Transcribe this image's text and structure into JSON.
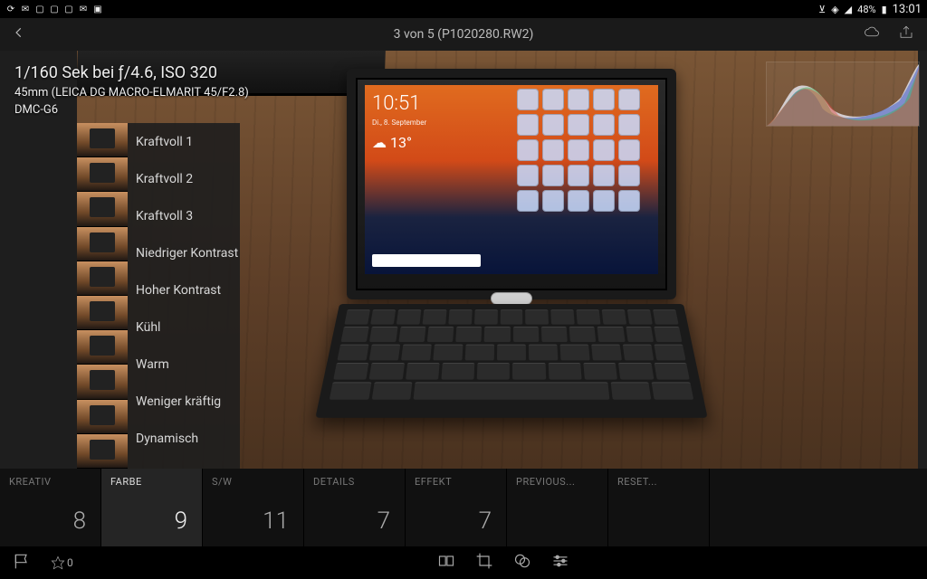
{
  "status_bar": {
    "left_icons": [
      "sync",
      "mail",
      "cal1",
      "cal2",
      "cal3",
      "msg",
      "image"
    ],
    "bluetooth": true,
    "wifi": true,
    "signal": true,
    "battery_pct": "48%",
    "time": "13:01"
  },
  "top": {
    "counter": "3 von 5 (P1020280.RW2)",
    "cloud": "cloud",
    "share": "share"
  },
  "metadata": {
    "exposure": "1/160 Sek bei ƒ/4.6, ISO 320",
    "lens": "45mm (LEICA DG MACRO-ELMARIT 45/F2.8)",
    "camera": "DMC-G6"
  },
  "presets": {
    "items": [
      {
        "label": "Kraftvoll 1"
      },
      {
        "label": "Kraftvoll 2"
      },
      {
        "label": "Kraftvoll 3"
      },
      {
        "label": "Niedriger Kontrast"
      },
      {
        "label": "Hoher Kontrast"
      },
      {
        "label": "Kühl"
      },
      {
        "label": "Warm"
      },
      {
        "label": "Weniger kräftig"
      },
      {
        "label": "Dynamisch"
      }
    ]
  },
  "tabs": {
    "items": [
      {
        "label": "KREATIV",
        "value": "8"
      },
      {
        "label": "FARBE",
        "value": "9",
        "active": true
      },
      {
        "label": "S/W",
        "value": "11"
      },
      {
        "label": "DETAILS",
        "value": "7"
      },
      {
        "label": "EFFEKT",
        "value": "7"
      },
      {
        "label": "PREVIOUS...",
        "value": ""
      },
      {
        "label": "RESET...",
        "value": ""
      }
    ]
  },
  "rating": {
    "stars": "0"
  }
}
